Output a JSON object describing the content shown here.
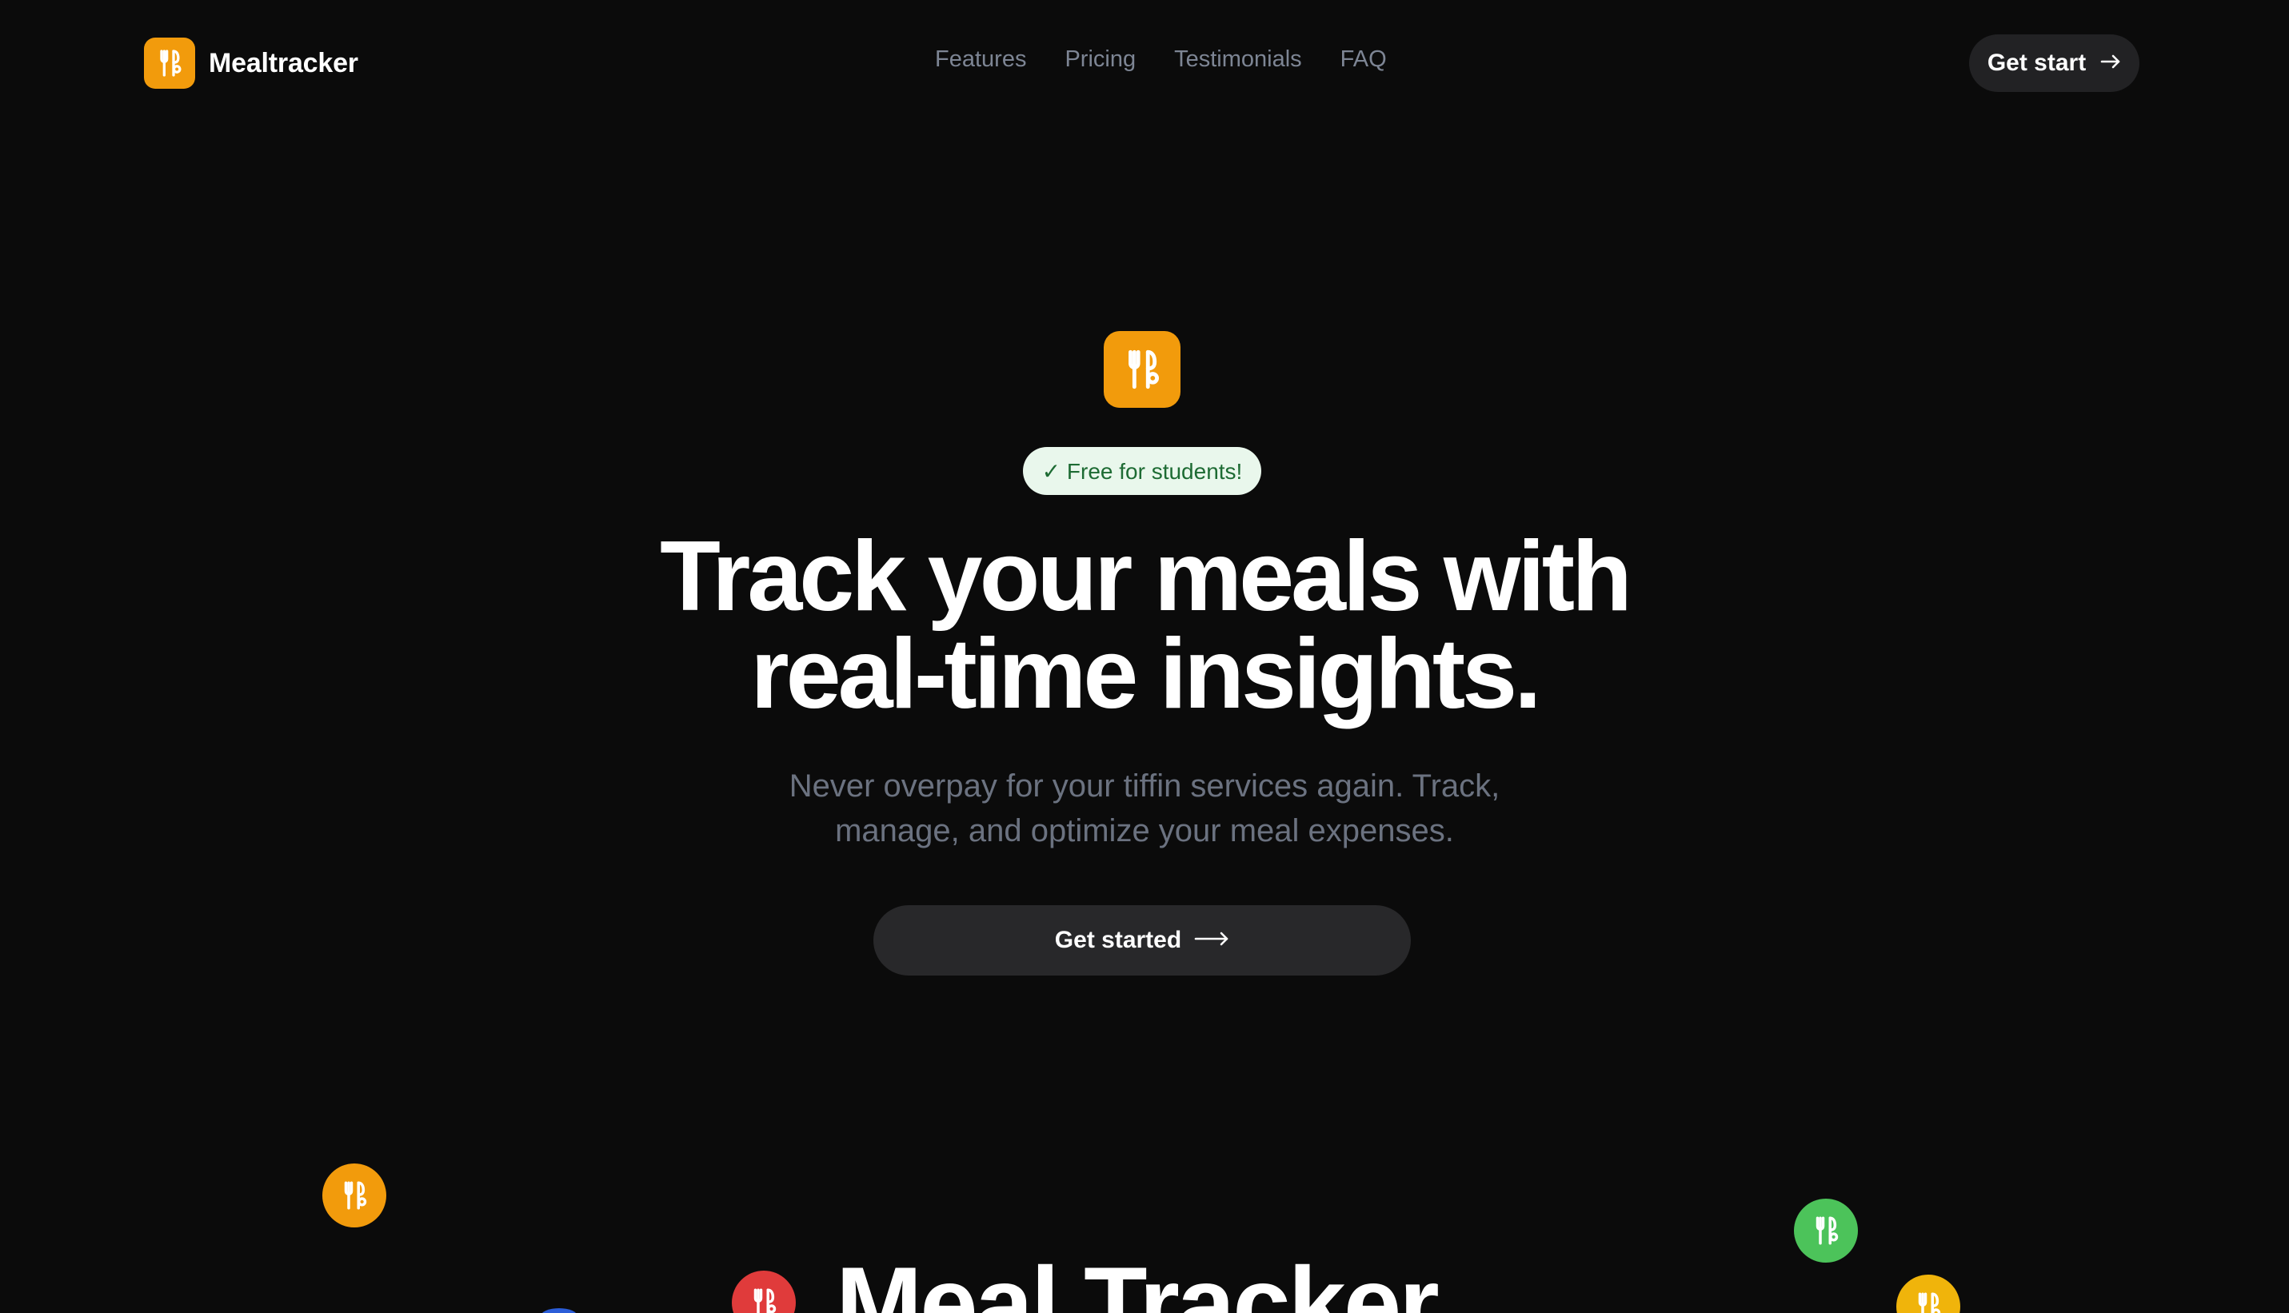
{
  "brand": {
    "name": "Mealtracker",
    "logo_icon": "utensils-icon",
    "accent_color": "#f29b0c"
  },
  "nav": {
    "items": [
      {
        "label": "Features"
      },
      {
        "label": "Pricing"
      },
      {
        "label": "Testimonials"
      },
      {
        "label": "FAQ"
      }
    ]
  },
  "header_cta": {
    "label": "Get start",
    "icon": "arrow-right-icon"
  },
  "hero": {
    "logo_icon": "utensils-icon",
    "badge": "✓ Free for students!",
    "headline_line1": "Track your meals with",
    "headline_line2": "real-time insights.",
    "subhead_line1": "Never overpay for your tiffin services again. Track,",
    "subhead_line2": "manage, and optimize your meal expenses.",
    "cta_label": "Get started",
    "cta_icon": "long-arrow-right-icon"
  },
  "floating_icons": [
    {
      "name": "utensils-icon",
      "color": "#f29b0c"
    },
    {
      "name": "utensils-icon",
      "color": "#e03b3b"
    },
    {
      "name": "utensils-icon",
      "color": "#4cc35a"
    },
    {
      "name": "utensils-icon",
      "color": "#f0b40b"
    }
  ],
  "section": {
    "title": "Meal Tracker"
  },
  "colors": {
    "background": "#0b0b0b",
    "badge_bg": "#e9f7ec",
    "badge_text": "#1d6b33",
    "muted_text": "#6b7280",
    "button_bg": "#28282a"
  }
}
